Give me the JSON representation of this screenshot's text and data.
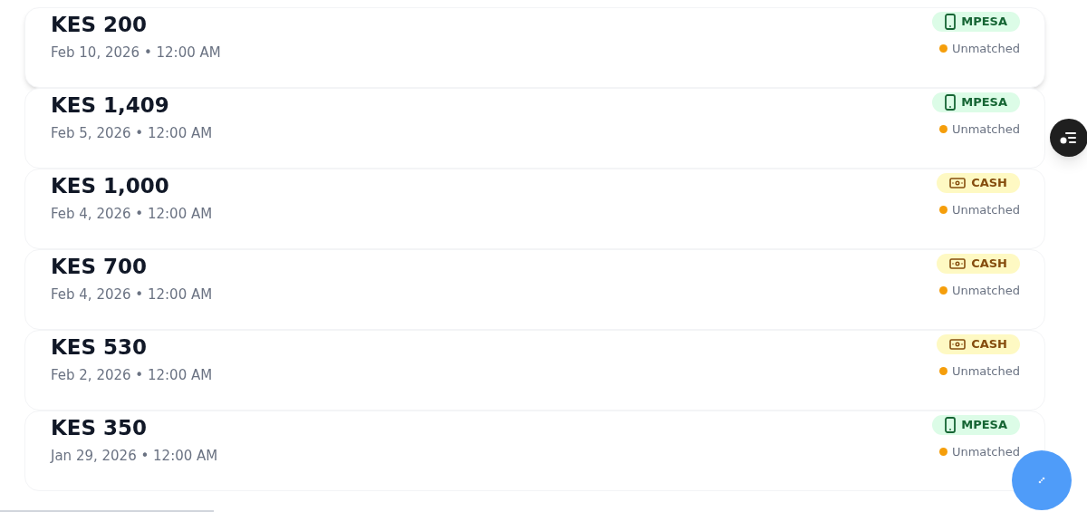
{
  "transactions": [
    {
      "amount": "KES 200",
      "date": "Feb 10, 2026 • 12:00 AM",
      "method": {
        "kind": "mpesa",
        "label": "MPESA"
      },
      "status": {
        "label": "Unmatched",
        "color": "#f59e0b"
      }
    },
    {
      "amount": "KES 1,409",
      "date": "Feb 5, 2026 • 12:00 AM",
      "method": {
        "kind": "mpesa",
        "label": "MPESA"
      },
      "status": {
        "label": "Unmatched",
        "color": "#f59e0b"
      }
    },
    {
      "amount": "KES 1,000",
      "date": "Feb 4, 2026 • 12:00 AM",
      "method": {
        "kind": "cash",
        "label": "CASH"
      },
      "status": {
        "label": "Unmatched",
        "color": "#f59e0b"
      }
    },
    {
      "amount": "KES 700",
      "date": "Feb 4, 2026 • 12:00 AM",
      "method": {
        "kind": "cash",
        "label": "CASH"
      },
      "status": {
        "label": "Unmatched",
        "color": "#f59e0b"
      }
    },
    {
      "amount": "KES 530",
      "date": "Feb 2, 2026 • 12:00 AM",
      "method": {
        "kind": "cash",
        "label": "CASH"
      },
      "status": {
        "label": "Unmatched",
        "color": "#f59e0b"
      }
    },
    {
      "amount": "KES 350",
      "date": "Jan 29, 2026 • 12:00 AM",
      "method": {
        "kind": "mpesa",
        "label": "MPESA"
      },
      "status": {
        "label": "Unmatched",
        "color": "#f59e0b"
      }
    }
  ]
}
